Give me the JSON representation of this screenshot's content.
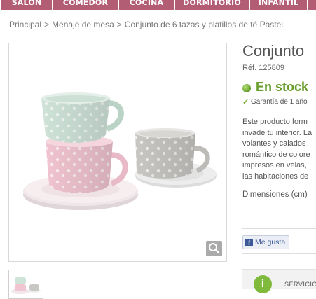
{
  "nav": {
    "items": [
      {
        "label": "SALÓN"
      },
      {
        "label": "COMEDOR"
      },
      {
        "label": "COCINA"
      },
      {
        "label": "DORMITORIO"
      },
      {
        "label": "INFANTIL"
      }
    ]
  },
  "breadcrumb": {
    "items": [
      "Principal",
      "Menaje de mesa",
      "Conjunto de 6 tazas y platillos de té Pastel"
    ],
    "separator": ">"
  },
  "product": {
    "title": "Conjunto",
    "ref": "Réf. 125809",
    "stock": "En stock",
    "warranty": "Garantía de 1 año",
    "description_lines": [
      "Este producto form",
      "invade tu interior. La",
      "volantes y calados",
      "romántico de colore",
      "impresos en velas,",
      "las habitaciones de"
    ],
    "dimensions_label": "Dimensiones (cm)",
    "like_label": "Me gusta",
    "service_label": "SERVICIO"
  },
  "icons": {
    "stock_dot": "green-dot-icon",
    "warranty": "check-icon",
    "zoom": "magnifier-icon",
    "facebook": "facebook-icon",
    "info": "info-icon"
  },
  "colors": {
    "nav_bg": "#b25d73",
    "stock_green": "#6a9e2c",
    "facebook_blue": "#3b5998"
  }
}
